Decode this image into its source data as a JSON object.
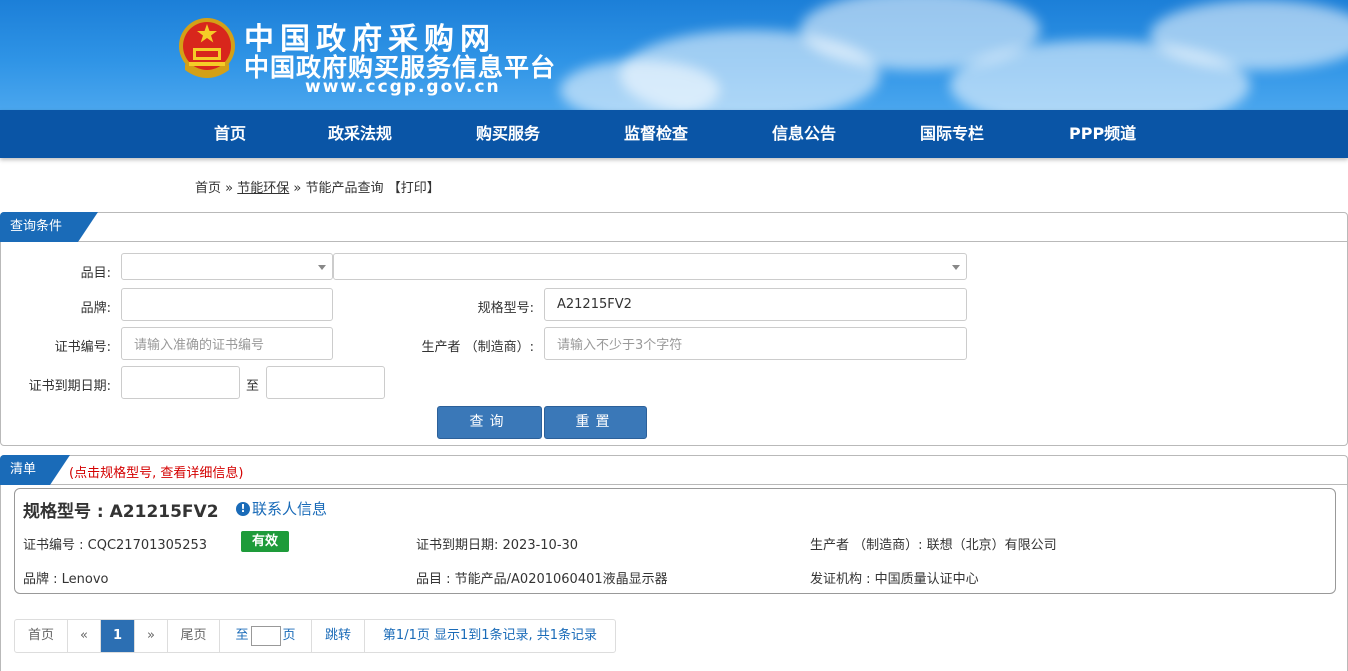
{
  "header": {
    "title_cn": "中国政府采购网",
    "subtitle_cn": "中国政府购买服务信息平台",
    "url": "www.ccgp.gov.cn"
  },
  "nav": {
    "items": [
      {
        "label": "首页"
      },
      {
        "label": "政采法规"
      },
      {
        "label": "购买服务"
      },
      {
        "label": "监督检查"
      },
      {
        "label": "信息公告"
      },
      {
        "label": "国际专栏"
      },
      {
        "label": "PPP频道"
      }
    ]
  },
  "breadcrumb": {
    "home": "首页",
    "sep1": "»",
    "section": "节能环保",
    "sep2": "»",
    "page": "节能产品查询",
    "print": "【打印】"
  },
  "query": {
    "tab_label": "查询条件",
    "category_label": "品目:",
    "category_value1": "",
    "category_value2": "",
    "brand_label": "品牌:",
    "brand_value": "",
    "model_label": "规格型号:",
    "model_value": "A21215FV2",
    "cert_label": "证书编号:",
    "cert_placeholder": "请输入准确的证书编号",
    "maker_label": "生产者 （制造商）:",
    "maker_placeholder": "请输入不少于3个字符",
    "expire_label": "证书到期日期:",
    "expire_to": "至",
    "expire_from_value": "",
    "expire_to_value": "",
    "search_button": "查询",
    "reset_button": "重置"
  },
  "results": {
    "tab_label": "清单",
    "hint": "(点击规格型号, 查看详细信息)",
    "items": [
      {
        "title": "规格型号 : A21215FV2",
        "contact": "联系人信息",
        "cert_no": "证书编号 : CQC21701305253",
        "status": "有效",
        "expire": "证书到期日期: 2023-10-30",
        "maker": "生产者 （制造商）: 联想（北京）有限公司",
        "brand": "品牌 : Lenovo",
        "category": "品目 : 节能产品/A0201060401液晶显示器",
        "issuer": "发证机构 : 中国质量认证中心"
      }
    ]
  },
  "pager": {
    "first": "首页",
    "prev": "«",
    "current": "1",
    "next": "»",
    "last": "尾页",
    "goto_prefix": "至",
    "goto_suffix": "页",
    "jump": "跳转",
    "summary": "第1/1页  显示1到1条记录, 共1条记录"
  },
  "colors": {
    "banner": "#2f94e6",
    "nav": "#0a55a6",
    "tab": "#1a6bb8",
    "button": "#3a78b8",
    "status_valid": "#1e9b3a",
    "hint": "#d40000"
  }
}
